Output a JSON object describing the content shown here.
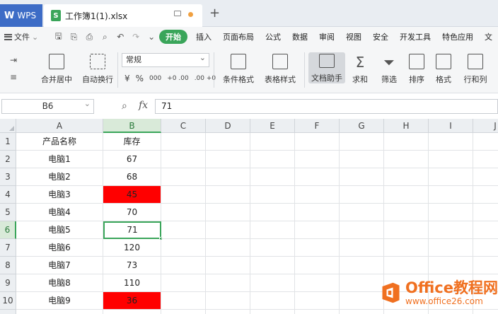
{
  "tabs": {
    "app": "WPS",
    "file": "工作簿1(1).xlsx",
    "add": "+"
  },
  "menu": {
    "file": "文件",
    "items": [
      "开始",
      "插入",
      "页面布局",
      "公式",
      "数据",
      "审阅",
      "视图",
      "安全",
      "开发工具",
      "特色应用",
      "文"
    ],
    "active_index": 0
  },
  "ribbon": {
    "merge_center": "合并居中",
    "wrap_text": "自动换行",
    "number_format": "常规",
    "number_buttons": [
      "¥",
      "%",
      "000",
      "+0 .00",
      ".00 +0"
    ],
    "cond_format": "条件格式",
    "table_style": "表格样式",
    "doc_assistant": "文档助手",
    "sum": "求和",
    "filter": "筛选",
    "sort": "排序",
    "format": "格式",
    "row_col": "行和列"
  },
  "formula_bar": {
    "cell_ref": "B6",
    "fx": "fx",
    "value": "71"
  },
  "sheet": {
    "columns": [
      "A",
      "B",
      "C",
      "D",
      "E",
      "F",
      "G",
      "H",
      "I",
      "J"
    ],
    "active_column": "B",
    "active_row": 6,
    "rows": [
      {
        "n": "1",
        "a": "产品名称",
        "b": "库存",
        "red": false
      },
      {
        "n": "2",
        "a": "电脑1",
        "b": "67",
        "red": false
      },
      {
        "n": "3",
        "a": "电脑2",
        "b": "68",
        "red": false
      },
      {
        "n": "4",
        "a": "电脑3",
        "b": "45",
        "red": true
      },
      {
        "n": "5",
        "a": "电脑4",
        "b": "70",
        "red": false
      },
      {
        "n": "6",
        "a": "电脑5",
        "b": "71",
        "red": false
      },
      {
        "n": "7",
        "a": "电脑6",
        "b": "120",
        "red": false
      },
      {
        "n": "8",
        "a": "电脑7",
        "b": "73",
        "red": false
      },
      {
        "n": "9",
        "a": "电脑8",
        "b": "110",
        "red": false
      },
      {
        "n": "10",
        "a": "电脑9",
        "b": "36",
        "red": true
      }
    ],
    "highlight_color": "#ff0000",
    "accent_color": "#3aa55a"
  },
  "watermark": {
    "title": "Office教程网",
    "url": "www.office26.com"
  }
}
